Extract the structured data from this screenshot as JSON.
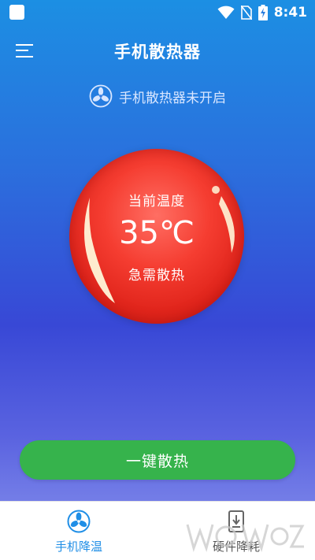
{
  "status_bar": {
    "time": "8:41",
    "icons": [
      "app-notification-icon",
      "wifi-icon",
      "no-sim-icon",
      "battery-charging-icon"
    ]
  },
  "header": {
    "title": "手机散热器",
    "menu_icon": "menu-icon"
  },
  "cooler_status": {
    "icon": "fan-icon",
    "text": "手机散热器未开启"
  },
  "temperature": {
    "label": "当前温度",
    "value": "35℃",
    "warning": "急需散热"
  },
  "action": {
    "label": "一键散热",
    "color": "#36b34c"
  },
  "bottom_nav": {
    "items": [
      {
        "label": "手机降温",
        "icon": "fan-icon",
        "active": true
      },
      {
        "label": "硬件降耗",
        "icon": "phone-download-icon",
        "active": false
      }
    ]
  },
  "colors": {
    "accent": "#1f8ee6",
    "ball_red": "#e0241b"
  }
}
